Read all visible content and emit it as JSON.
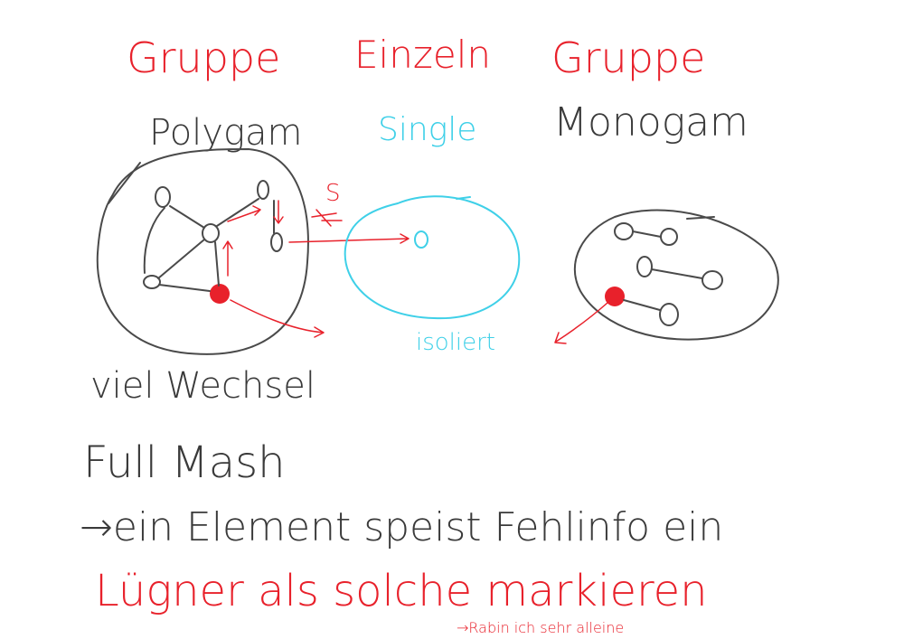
{
  "headings": {
    "group_left": "Gruppe",
    "single": "Einzeln",
    "group_right": "Gruppe"
  },
  "labels": {
    "polygam": "Polygam",
    "single": "Single",
    "monogam": "Monogam",
    "isoliert": "isoliert",
    "viel_wechsel": "viel Wechsel",
    "s_mark": "S",
    "full_mesh": "Full Mash",
    "element_line": "→ein Element speist Fehlinfo ein",
    "luegner_line": "Lügner als solche markieren",
    "footnote": "→Rabin ich sehr alleine"
  },
  "colors": {
    "red": "#e8212b",
    "cyan": "#3fd0e8",
    "grey": "#3a3a3a"
  }
}
